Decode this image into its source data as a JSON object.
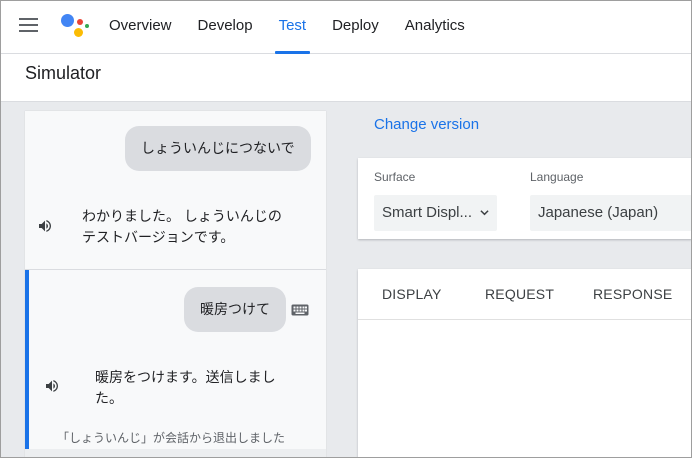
{
  "nav": {
    "tabs": [
      {
        "label": "Overview"
      },
      {
        "label": "Develop"
      },
      {
        "label": "Test"
      },
      {
        "label": "Deploy"
      },
      {
        "label": "Analytics"
      }
    ],
    "active_tab": "Test"
  },
  "simulator": {
    "title": "Simulator"
  },
  "chat": {
    "turns": [
      {
        "user": "しょういんじにつないで",
        "reply_line1": "わかりました。 しょういんじの",
        "reply_line2": "テストバージョンです。"
      },
      {
        "user": "暖房つけて",
        "reply_line1": "暖房をつけます。送信しまし",
        "reply_line2": "た。"
      }
    ],
    "exit_note": "「しょういんじ」が会話から退出しました"
  },
  "settings": {
    "change_version": "Change version",
    "surface_label": "Surface",
    "surface_value": "Smart Displ...",
    "language_label": "Language",
    "language_value": "Japanese (Japan)"
  },
  "result_tabs": [
    {
      "label": "DISPLAY"
    },
    {
      "label": "REQUEST"
    },
    {
      "label": "RESPONSE"
    }
  ],
  "colors": {
    "accent": "#1a73e8",
    "google_blue": "#4285f4",
    "google_red": "#ea4335",
    "google_yellow": "#fbbc04",
    "google_green": "#34a853"
  }
}
